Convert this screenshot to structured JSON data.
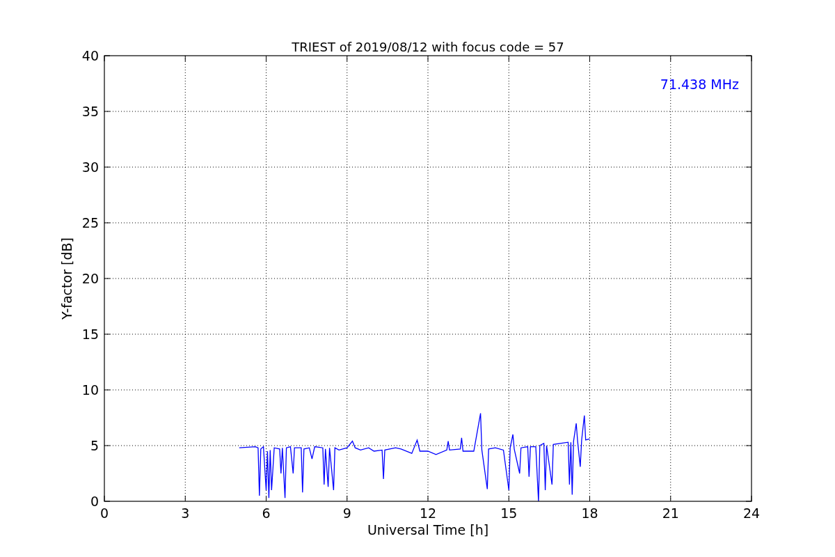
{
  "chart": {
    "chart_data": {
      "type": "line",
      "title": "TRIEST of 2019/08/12 with focus code = 57",
      "xlabel": "Universal Time [h]",
      "ylabel": "Y-factor [dB]",
      "xlim": [
        0,
        24
      ],
      "ylim": [
        0,
        40
      ],
      "xticks": [
        0,
        3,
        6,
        9,
        12,
        15,
        18,
        21,
        24
      ],
      "yticks": [
        0,
        5,
        10,
        15,
        20,
        25,
        30,
        35,
        40
      ],
      "x": [
        5.0,
        5.3,
        5.6,
        5.7,
        5.75,
        5.8,
        5.9,
        6.0,
        6.05,
        6.1,
        6.15,
        6.2,
        6.3,
        6.5,
        6.55,
        6.6,
        6.7,
        6.75,
        6.9,
        7.0,
        7.05,
        7.3,
        7.35,
        7.4,
        7.6,
        7.7,
        7.8,
        8.1,
        8.15,
        8.2,
        8.3,
        8.35,
        8.5,
        8.55,
        8.7,
        9.0,
        9.2,
        9.3,
        9.5,
        9.8,
        10.0,
        10.3,
        10.35,
        10.4,
        10.8,
        11.0,
        11.4,
        11.6,
        11.7,
        12.0,
        12.3,
        12.7,
        12.75,
        12.8,
        13.2,
        13.25,
        13.3,
        13.7,
        13.95,
        14.0,
        14.2,
        14.25,
        14.5,
        14.8,
        15.0,
        15.05,
        15.15,
        15.2,
        15.4,
        15.45,
        15.7,
        15.75,
        15.8,
        16.0,
        16.1,
        16.15,
        16.3,
        16.35,
        16.4,
        16.6,
        16.65,
        16.9,
        17.2,
        17.25,
        17.3,
        17.35,
        17.4,
        17.5,
        17.55,
        17.65,
        17.7,
        17.8,
        17.85,
        18.0
      ],
      "series": [
        {
          "name": "71.438 MHz",
          "color": "#0000ff",
          "values": [
            4.8,
            4.85,
            4.9,
            4.8,
            0.5,
            4.7,
            4.9,
            1.0,
            4.5,
            0.3,
            4.6,
            1.0,
            4.8,
            4.7,
            2.5,
            4.8,
            0.3,
            4.8,
            4.9,
            2.5,
            4.8,
            4.8,
            0.8,
            4.7,
            4.8,
            3.8,
            4.9,
            4.8,
            1.5,
            4.7,
            1.3,
            4.8,
            1.0,
            4.8,
            4.6,
            4.8,
            5.4,
            4.8,
            4.6,
            4.8,
            4.5,
            4.6,
            2.0,
            4.6,
            4.8,
            4.7,
            4.3,
            5.5,
            4.5,
            4.5,
            4.2,
            4.6,
            5.4,
            4.6,
            4.7,
            5.7,
            4.5,
            4.5,
            7.9,
            4.6,
            1.1,
            4.7,
            4.8,
            4.6,
            1.0,
            4.8,
            6.0,
            4.7,
            2.5,
            4.8,
            4.9,
            2.2,
            4.9,
            4.9,
            0.0,
            5.0,
            5.2,
            1.0,
            5.0,
            1.5,
            5.1,
            5.2,
            5.3,
            1.5,
            5.3,
            0.6,
            5.4,
            7.0,
            5.4,
            3.1,
            5.5,
            7.7,
            5.5,
            5.6
          ]
        }
      ],
      "grid": true
    }
  }
}
